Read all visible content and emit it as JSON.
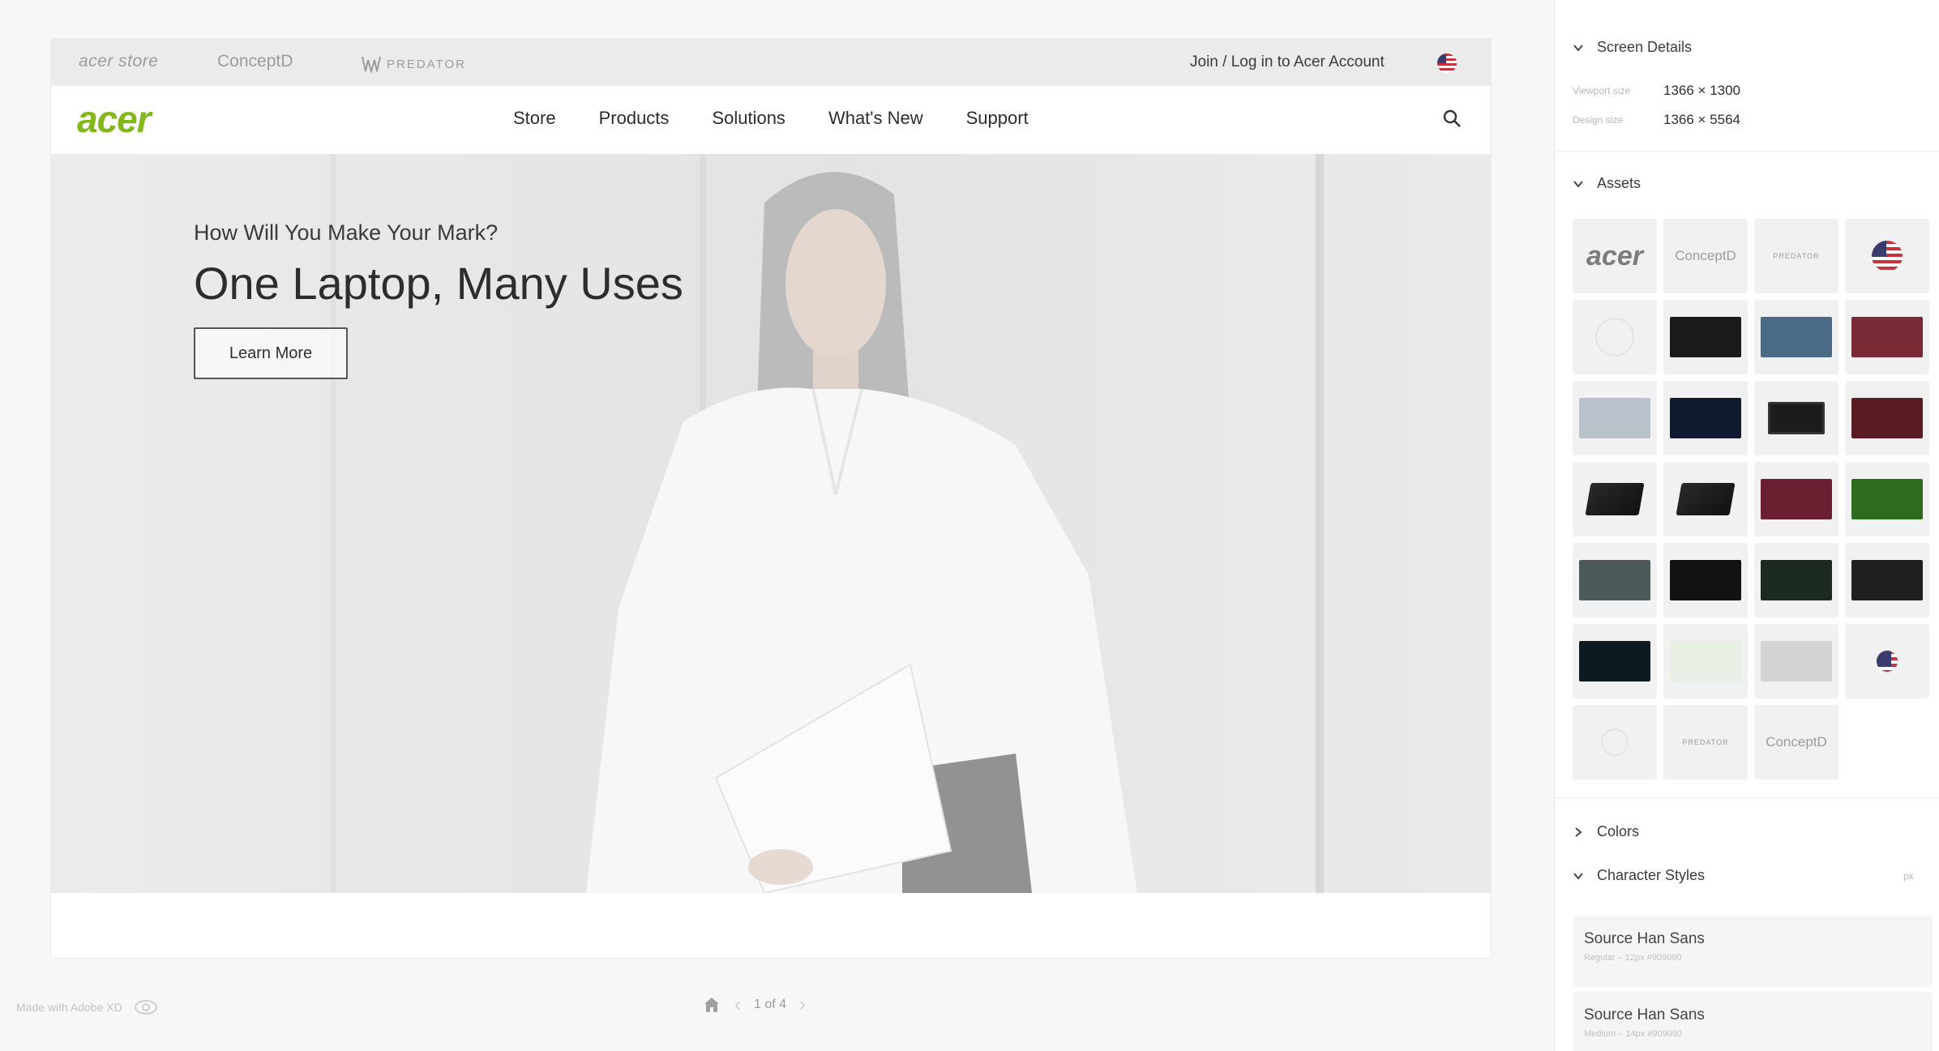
{
  "artboard": {
    "utility_bar": {
      "brands": [
        "acer store",
        "ConceptD",
        "PREDATOR"
      ],
      "account_link": "Join / Log in to Acer Account"
    },
    "main_nav": {
      "logo": "acer",
      "links": [
        "Store",
        "Products",
        "Solutions",
        "What's New",
        "Support"
      ]
    },
    "hero": {
      "kicker": "How Will You Make Your Mark?",
      "title": "One Laptop, Many Uses",
      "cta": "Learn More"
    }
  },
  "viewer_footer": {
    "made_with": "Made with Adobe XD",
    "page_indicator": "1 of 4"
  },
  "inspector": {
    "screen_details": {
      "heading": "Screen Details",
      "viewport_label": "Viewport size",
      "viewport_value": "1366 × 1300",
      "design_label": "Design size",
      "design_value": "1366 × 5564"
    },
    "assets": {
      "heading": "Assets",
      "tiles": [
        {
          "kind": "logo",
          "label": "acer"
        },
        {
          "kind": "text",
          "label": "ConceptD"
        },
        {
          "kind": "pred",
          "label": "PREDATOR"
        },
        {
          "kind": "flag"
        },
        {
          "kind": "ring"
        },
        {
          "kind": "img",
          "color": "#1a1a1a"
        },
        {
          "kind": "img",
          "color": "#4a6a86"
        },
        {
          "kind": "img",
          "color": "#7a2a34"
        },
        {
          "kind": "img",
          "color": "#b9c2cb"
        },
        {
          "kind": "img",
          "color": "#0f1a2e"
        },
        {
          "kind": "mon"
        },
        {
          "kind": "img",
          "color": "#5a1c22"
        },
        {
          "kind": "lap"
        },
        {
          "kind": "lap"
        },
        {
          "kind": "img",
          "color": "#6a2030"
        },
        {
          "kind": "img",
          "color": "#2f6b1f"
        },
        {
          "kind": "img",
          "color": "#4d5a5c"
        },
        {
          "kind": "img",
          "color": "#121212"
        },
        {
          "kind": "img",
          "color": "#1c2a22"
        },
        {
          "kind": "img",
          "color": "#202020"
        },
        {
          "kind": "img",
          "color": "#0d1a20"
        },
        {
          "kind": "img",
          "color": "#e8efe4"
        },
        {
          "kind": "img",
          "color": "#d4d4d4"
        },
        {
          "kind": "flag-sm"
        },
        {
          "kind": "ring-sm"
        },
        {
          "kind": "pred",
          "label": "PREDATOR"
        },
        {
          "kind": "text",
          "label": "ConceptD"
        }
      ]
    },
    "colors": {
      "heading": "Colors"
    },
    "character_styles": {
      "heading": "Character Styles",
      "unit": "px",
      "styles": [
        {
          "name": "Source Han Sans",
          "meta": "Regular – 12px #909090"
        },
        {
          "name": "Source Han Sans",
          "meta": "Medium – 14px #909090"
        }
      ]
    }
  },
  "colors": {
    "brand_green": "#83b81a",
    "canvas_bg": "#f7f7f7",
    "util_bar_bg": "#ebebeb"
  }
}
